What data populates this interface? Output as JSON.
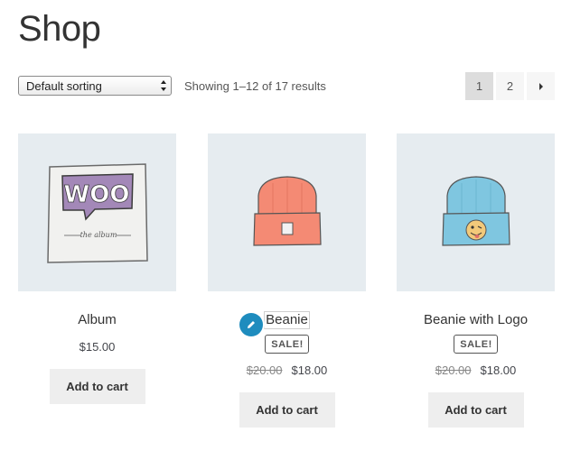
{
  "page": {
    "title": "Shop"
  },
  "toolbar": {
    "sort_value": "Default sorting",
    "result_count": "Showing 1–12 of 17 results",
    "pages": [
      "1",
      "2"
    ],
    "current_page": "1"
  },
  "products": [
    {
      "name": "Album",
      "on_sale": false,
      "price": "$15.00",
      "button": "Add to cart",
      "image_text_logo": "WOO",
      "image_text_sub": "the album"
    },
    {
      "name": "Beanie",
      "on_sale": true,
      "sale_label": "SALE!",
      "regular_price": "$20.00",
      "price": "$18.00",
      "button": "Add to cart"
    },
    {
      "name": "Beanie with Logo",
      "on_sale": true,
      "sale_label": "SALE!",
      "regular_price": "$20.00",
      "price": "$18.00",
      "button": "Add to cart"
    }
  ],
  "colors": {
    "thumb_bg": "#e6ecf0",
    "edit_blue": "#1e8cbe",
    "button_bg": "#eeeeee",
    "woo_purple": "#a388b8",
    "beanie_red": "#f48a74",
    "beanie_blue": "#7fc6e0"
  },
  "icons": {
    "edit": "pencil-icon",
    "next": "chevron-right-icon",
    "select": "select-arrows-icon"
  }
}
